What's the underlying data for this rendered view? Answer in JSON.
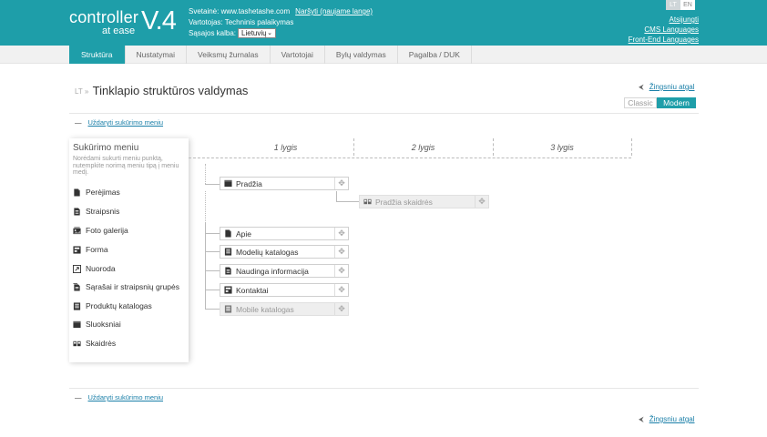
{
  "header": {
    "logo_line1": "controller",
    "logo_line2": "at ease",
    "logo_version": "V.4",
    "site_label": "Svetainė: www.tashetashe.com",
    "site_link": "Naršyti (naujame lange)",
    "user_label": "Vartotojas: Techninis palaikymas",
    "lang_label": "Sąsajos kalba:",
    "lang_value": "Lietuvių",
    "lang_lt": "LT",
    "lang_en": "EN",
    "logout": "Atsijungti",
    "cms_languages": "CMS Languages",
    "frontend_languages": "Front-End Languages",
    "brand_color": "#1e9ea9"
  },
  "nav": {
    "items": [
      "Struktūra",
      "Nustatymai",
      "Veiksmų žurnalas",
      "Vartotojai",
      "Bylų valdymas",
      "Pagalba / DUK"
    ],
    "active": "Struktūra"
  },
  "page": {
    "crumb": "LT »",
    "title": "Tinklapio struktūros valdymas",
    "back_link": "Žingsniu atgal",
    "view_classic": "Classic",
    "view_modern": "Modern",
    "close_menu": "Uždaryti sukūrimo meniu"
  },
  "panel": {
    "title": "Sukūrimo meniu",
    "description": "Norėdami sukurti meniu punktą, nutempkite norimą meniu tipą į meniu medį.",
    "types": [
      {
        "label": "Perėjimas",
        "icon": "file-icon"
      },
      {
        "label": "Straipsnis",
        "icon": "article-icon"
      },
      {
        "label": "Foto galerija",
        "icon": "gallery-icon"
      },
      {
        "label": "Forma",
        "icon": "form-icon"
      },
      {
        "label": "Nuoroda",
        "icon": "link-icon"
      },
      {
        "label": "Sąrašai ir straipsnių grupės",
        "icon": "list-icon"
      },
      {
        "label": "Produktų katalogas",
        "icon": "catalog-icon"
      },
      {
        "label": "Sluoksniai",
        "icon": "layers-icon"
      },
      {
        "label": "Skaidrės",
        "icon": "slides-icon"
      }
    ]
  },
  "structure": {
    "levels": [
      "1 lygis",
      "2 lygis",
      "3 lygis"
    ],
    "nodes": [
      {
        "label": "Pradžia",
        "icon": "layers-icon",
        "level": 1,
        "dim": false
      },
      {
        "label": "Pradžia skaidrės",
        "icon": "slides-icon",
        "level": 2,
        "dim": true
      },
      {
        "label": "Apie",
        "icon": "file-icon",
        "level": 1,
        "dim": false
      },
      {
        "label": "Modelių katalogas",
        "icon": "catalog-icon",
        "level": 1,
        "dim": false
      },
      {
        "label": "Naudinga informacija",
        "icon": "article-icon",
        "level": 1,
        "dim": false
      },
      {
        "label": "Kontaktai",
        "icon": "form-icon",
        "level": 1,
        "dim": false
      },
      {
        "label": "Mobile katalogas",
        "icon": "catalog-icon",
        "level": 1,
        "dim": true
      }
    ]
  }
}
